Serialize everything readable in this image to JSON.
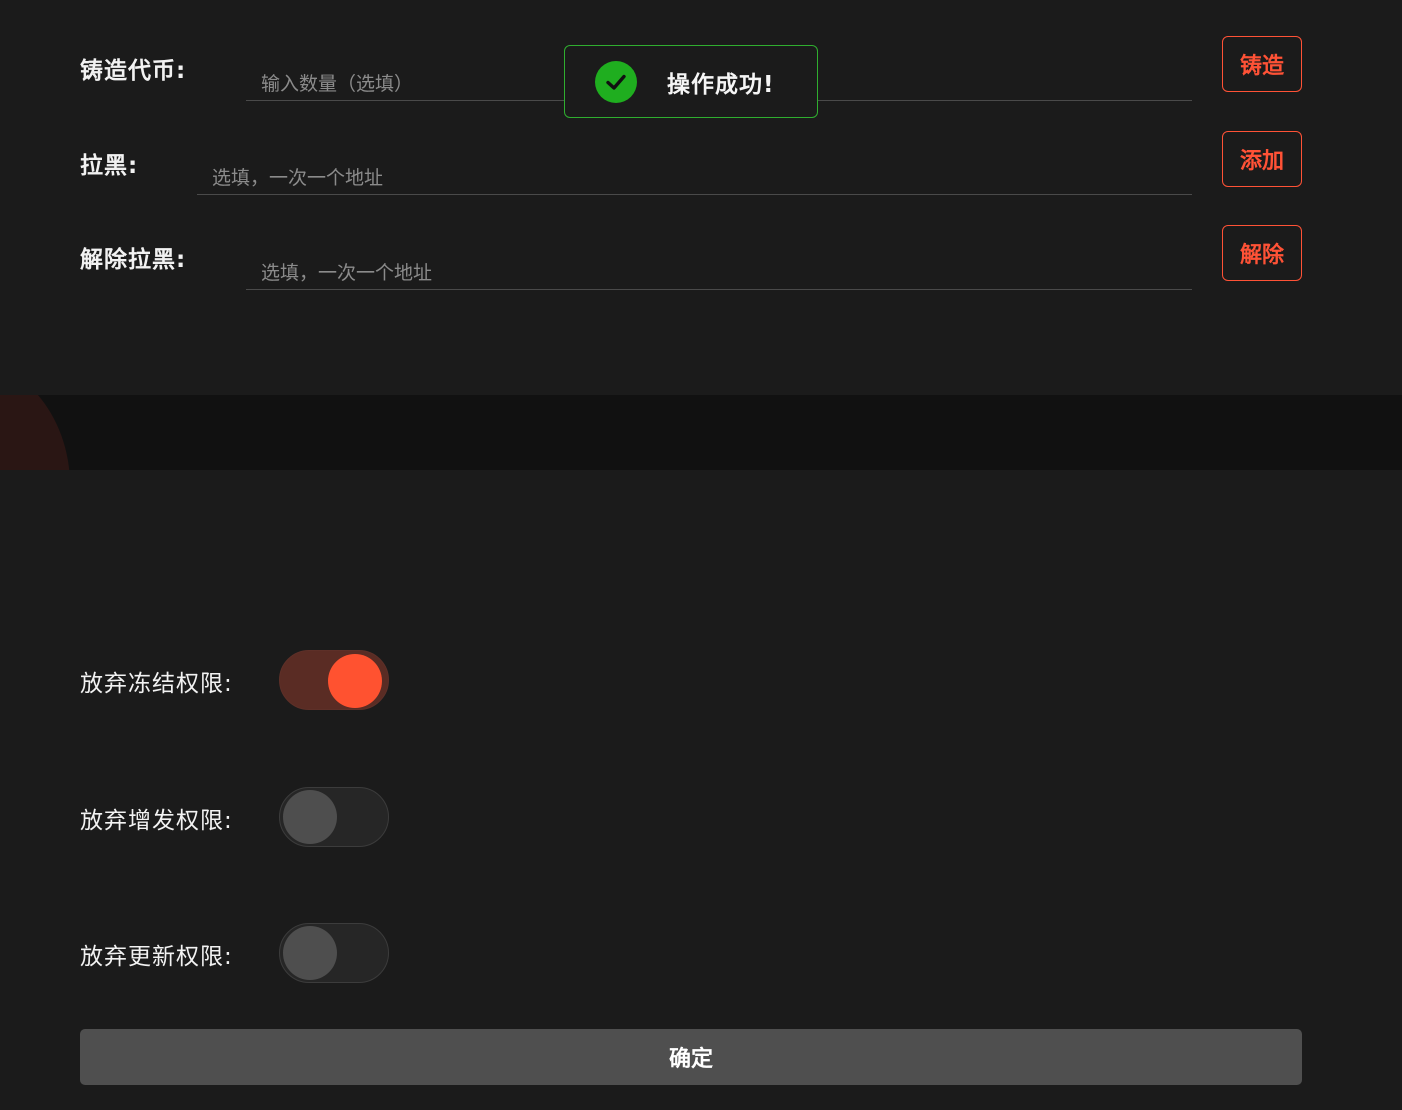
{
  "form": {
    "mint": {
      "label": "铸造代币:",
      "placeholder": "输入数量（选填）",
      "button": "铸造"
    },
    "blacklist": {
      "label": "拉黑:",
      "placeholder": "选填，一次一个地址",
      "button": "添加"
    },
    "unblacklist": {
      "label": "解除拉黑:",
      "placeholder": "选填，一次一个地址",
      "button": "解除"
    }
  },
  "toast": {
    "message": "操作成功!",
    "icon": "check-circle-icon"
  },
  "permissions": [
    {
      "label": "放弃冻结权限:",
      "enabled": true
    },
    {
      "label": "放弃增发权限:",
      "enabled": false
    },
    {
      "label": "放弃更新权限:",
      "enabled": false
    }
  ],
  "confirm_label": "确定",
  "colors": {
    "accent": "#ff5236",
    "success": "#1fae1f",
    "background": "#1b1b1b",
    "button_disabled": "#4f4f4f"
  }
}
